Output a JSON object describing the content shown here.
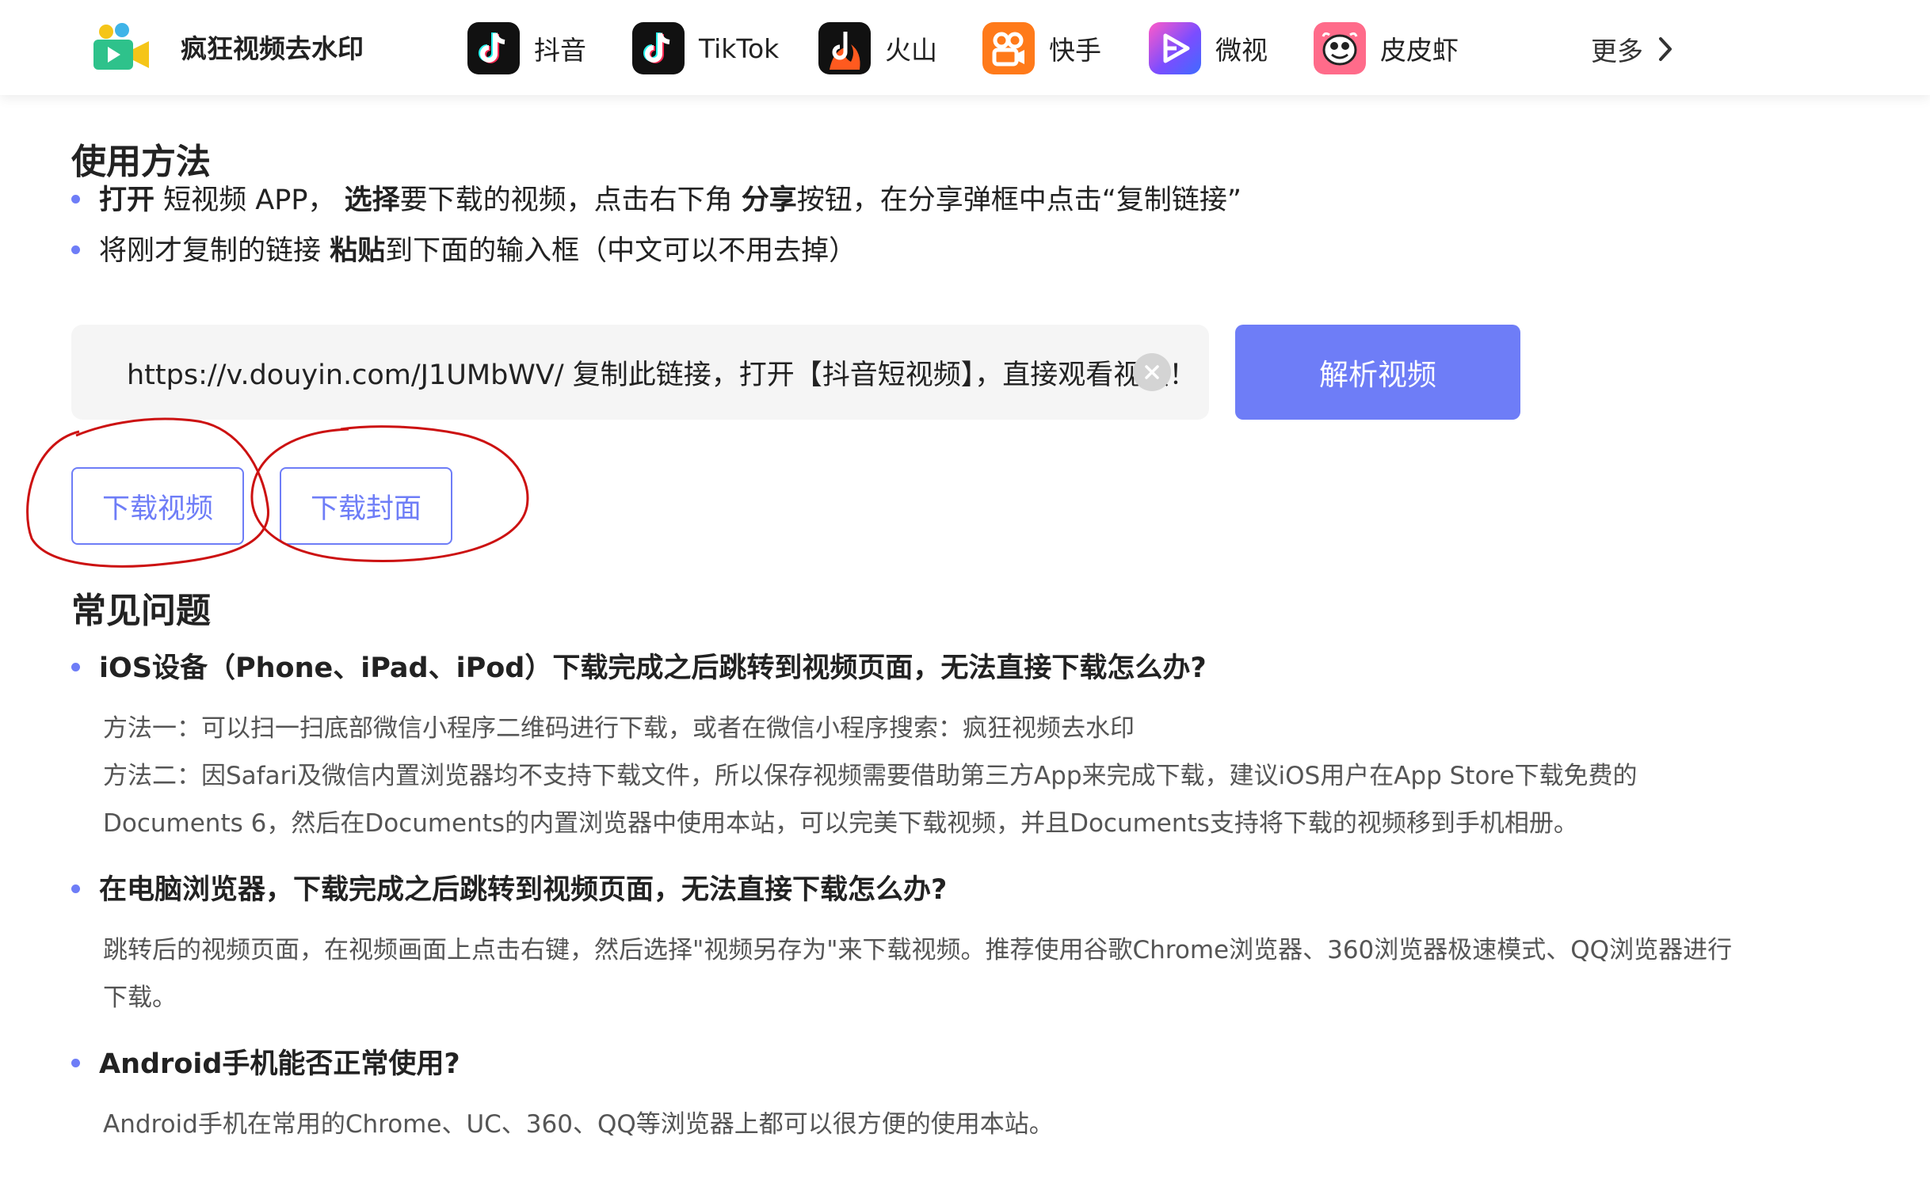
{
  "header": {
    "site_name": "疯狂视频去水印",
    "nav": [
      {
        "label": "抖音",
        "icon": "douyin-icon"
      },
      {
        "label": "TikTok",
        "icon": "tiktok-icon"
      },
      {
        "label": "火山",
        "icon": "huoshan-icon"
      },
      {
        "label": "快手",
        "icon": "kuaishou-icon"
      },
      {
        "label": "微视",
        "icon": "weishi-icon"
      },
      {
        "label": "皮皮虾",
        "icon": "pipixia-icon"
      }
    ],
    "more_label": "更多",
    "colors": {
      "kuaishou": "#ff7a1a",
      "weishi": "#7b4dff",
      "pipixia": "#ff6b8a",
      "dark_icon": "#111111"
    }
  },
  "usage": {
    "title": "使用方法",
    "step1": {
      "b1": "打开",
      "t1": " 短视频 APP， ",
      "b2": "选择",
      "t2": "要下载的视频，点击右下角 ",
      "b3": "分享",
      "t3": "按钮，在分享弹框中点击“复制链接”"
    },
    "step2": {
      "t1": "将刚才复制的链接 ",
      "b1": "粘贴",
      "t2": "到下面的输入框（中文可以不用去掉）"
    }
  },
  "input": {
    "value": "https://v.douyin.com/J1UMbWV/ 复制此链接，打开【抖音短视频】，直接观看视频！"
  },
  "parse_button": "解析视频",
  "download_video": "下载视频",
  "download_cover": "下载封面",
  "faq": {
    "title": "常见问题",
    "q1": "iOS设备（Phone、iPad、iPod）下载完成之后跳转到视频页面，无法直接下载怎么办?",
    "a1_1": "方法一：可以扫一扫底部微信小程序二维码进行下载，或者在微信小程序搜索：疯狂视频去水印",
    "a1_2": "方法二：因Safari及微信内置浏览器均不支持下载文件，所以保存视频需要借助第三方App来完成下载，建议iOS用户在App Store下载免费的",
    "a1_3": "Documents 6，然后在Documents的内置浏览器中使用本站，可以完美下载视频，并且Documents支持将下载的视频移到手机相册。",
    "q2": "在电脑浏览器，下载完成之后跳转到视频页面，无法直接下载怎么办?",
    "a2_1": "跳转后的视频页面，在视频画面上点击右键，然后选择\"视频另存为\"来下载视频。推荐使用谷歌Chrome浏览器、360浏览器极速模式、QQ浏览器进行",
    "a2_2": "下载。",
    "q3": "Android手机能否正常使用?",
    "a3": "Android手机在常用的Chrome、UC、360、QQ等浏览器上都可以很方便的使用本站。"
  },
  "accent_color": "#6e7df7",
  "annotation_color": "#cc1111"
}
